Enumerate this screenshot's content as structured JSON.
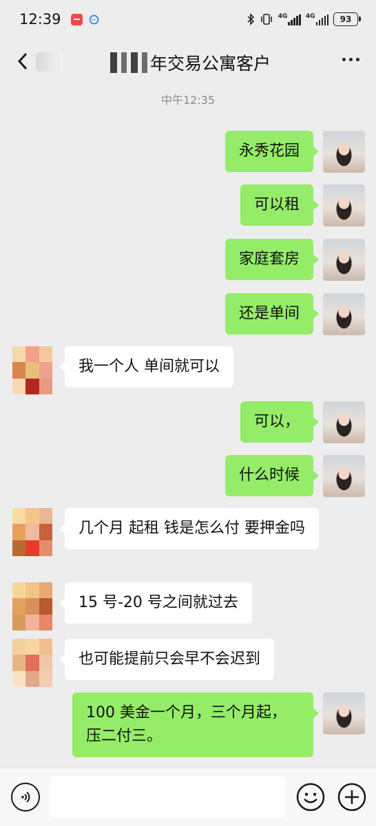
{
  "status": {
    "time": "12:39",
    "net1": "4G",
    "net2": "4G",
    "battery": "93"
  },
  "header": {
    "title": "年交易公寓客户"
  },
  "timestamp": "中午12:35",
  "messages": [
    {
      "side": "out",
      "text": "永秀花园"
    },
    {
      "side": "out",
      "text": "可以租"
    },
    {
      "side": "out",
      "text": "家庭套房"
    },
    {
      "side": "out",
      "text": "还是单间"
    },
    {
      "side": "in",
      "text": "我一个人  单间就可以"
    },
    {
      "side": "out",
      "text": "可以，"
    },
    {
      "side": "out",
      "text": "什么时候"
    },
    {
      "side": "in",
      "text": "几个月 起租 钱是怎么付  要押金吗"
    },
    {
      "side": "in",
      "text": "15 号-20 号之间就过去"
    },
    {
      "side": "in",
      "text": "也可能提前只会早不会迟到"
    },
    {
      "side": "out",
      "text": "100 美金一个月，三个月起，压二付三。"
    }
  ],
  "input": {
    "placeholder": ""
  }
}
